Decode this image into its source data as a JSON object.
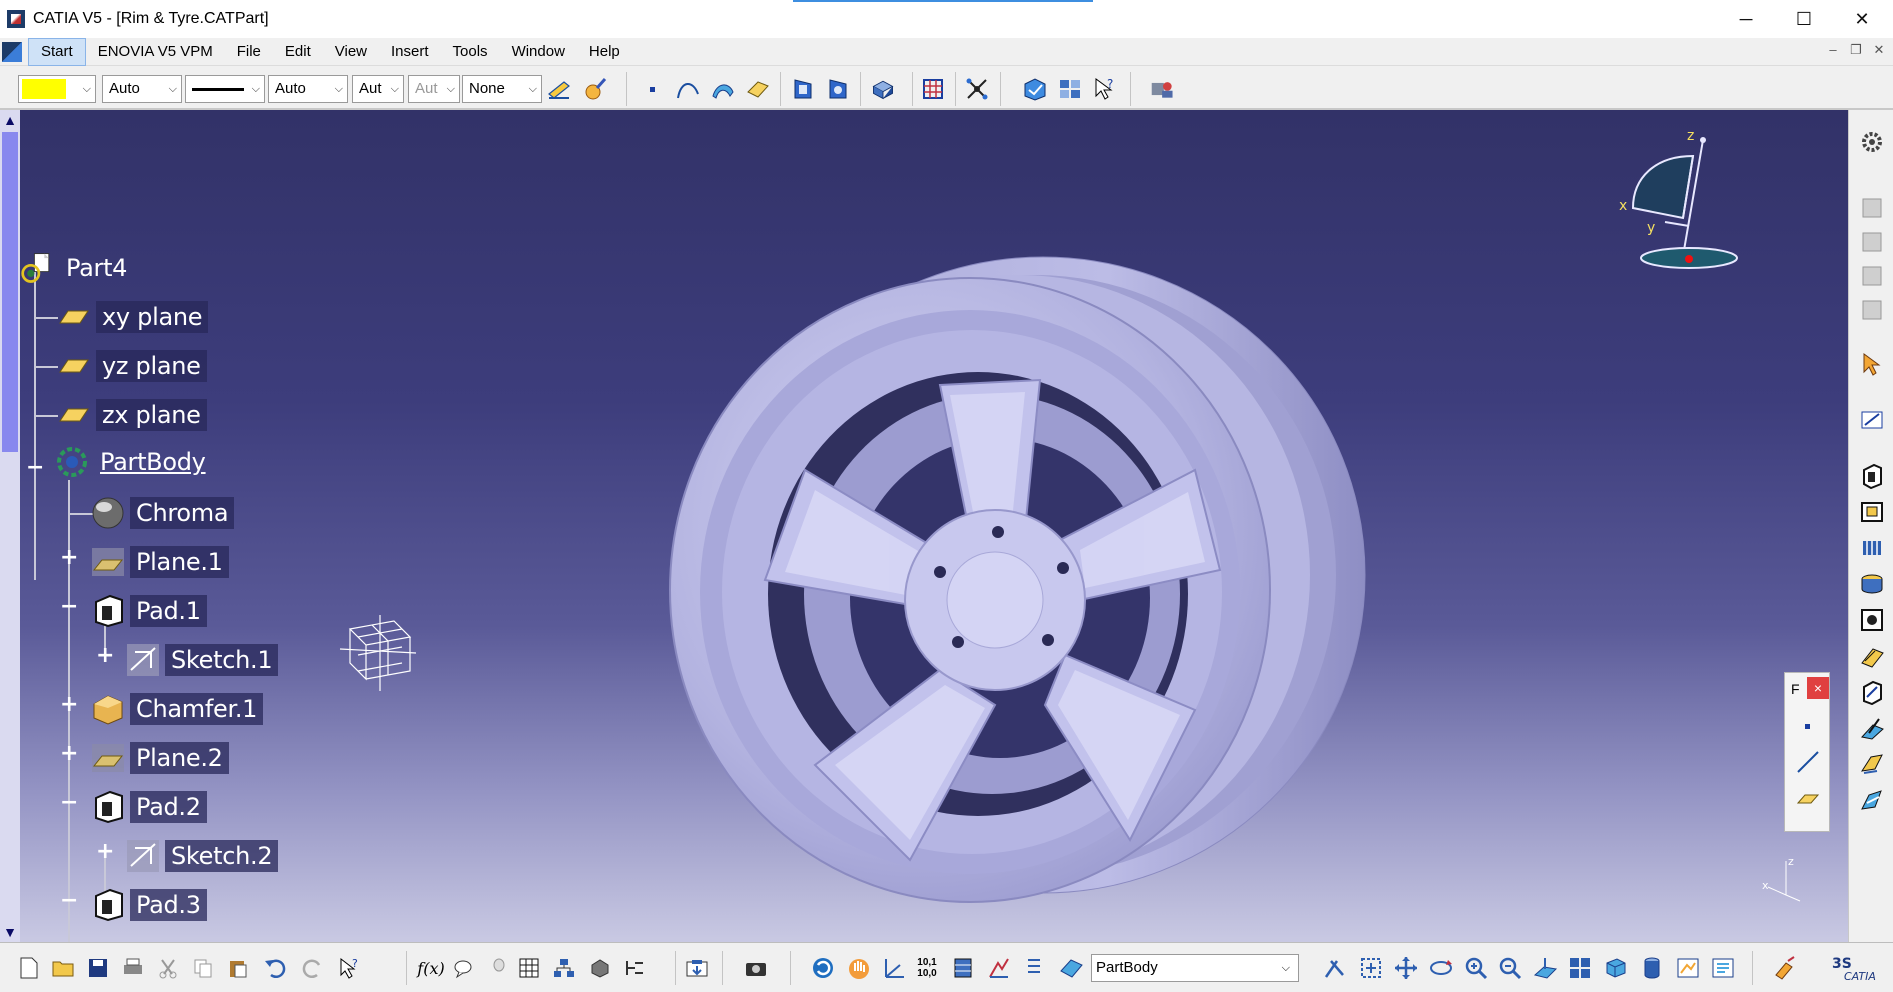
{
  "window": {
    "title": "CATIA V5 - [Rim & Tyre.CATPart]",
    "minimize_glyph": "─",
    "maximize_glyph": "☐",
    "close_glyph": "✕"
  },
  "menu": {
    "items": [
      "Start",
      "ENOVIA V5 VPM",
      "File",
      "Edit",
      "View",
      "Insert",
      "Tools",
      "Window",
      "Help"
    ],
    "mdi_minimize": "–",
    "mdi_restore": "❐",
    "mdi_close": "✕"
  },
  "properties_toolbar": {
    "color_swatch": "#ffff00",
    "transparency": "Auto",
    "linetype": "Auto",
    "thickness": "Aut",
    "point_symbol": "Aut",
    "layer": "None"
  },
  "spec_tree": {
    "root": "Part4",
    "planes": [
      "xy plane",
      "yz plane",
      "zx plane"
    ],
    "body": "PartBody",
    "features": {
      "chroma": "Chroma",
      "plane1": "Plane.1",
      "pad1": "Pad.1",
      "sketch1": "Sketch.1",
      "chamfer1": "Chamfer.1",
      "plane2": "Plane.2",
      "pad2": "Pad.2",
      "sketch2": "Sketch.2",
      "pad3": "Pad.3"
    },
    "expand_glyph": "+",
    "collapse_glyph": "−"
  },
  "compass": {
    "x_label": "x",
    "y_label": "y",
    "z_label": "z"
  },
  "mini_axis": {
    "x_label": "x",
    "z_label": "z"
  },
  "floating_panel": {
    "title": "F",
    "close_glyph": "×"
  },
  "bottom_toolbar": {
    "current_body": "PartBody",
    "formula_label": "f(x)",
    "scale_label_top": "10,1",
    "scale_label_bottom": "10,0"
  },
  "scrollbar": {
    "up_glyph": "▲",
    "down_glyph": "▼"
  },
  "dropdown_arrow": "⌵",
  "colors": {
    "viewport_top": "#323268",
    "viewport_bottom": "#c9c9e3",
    "part_color": "#b9b9e6",
    "tree_label_bg": "#28285a"
  }
}
